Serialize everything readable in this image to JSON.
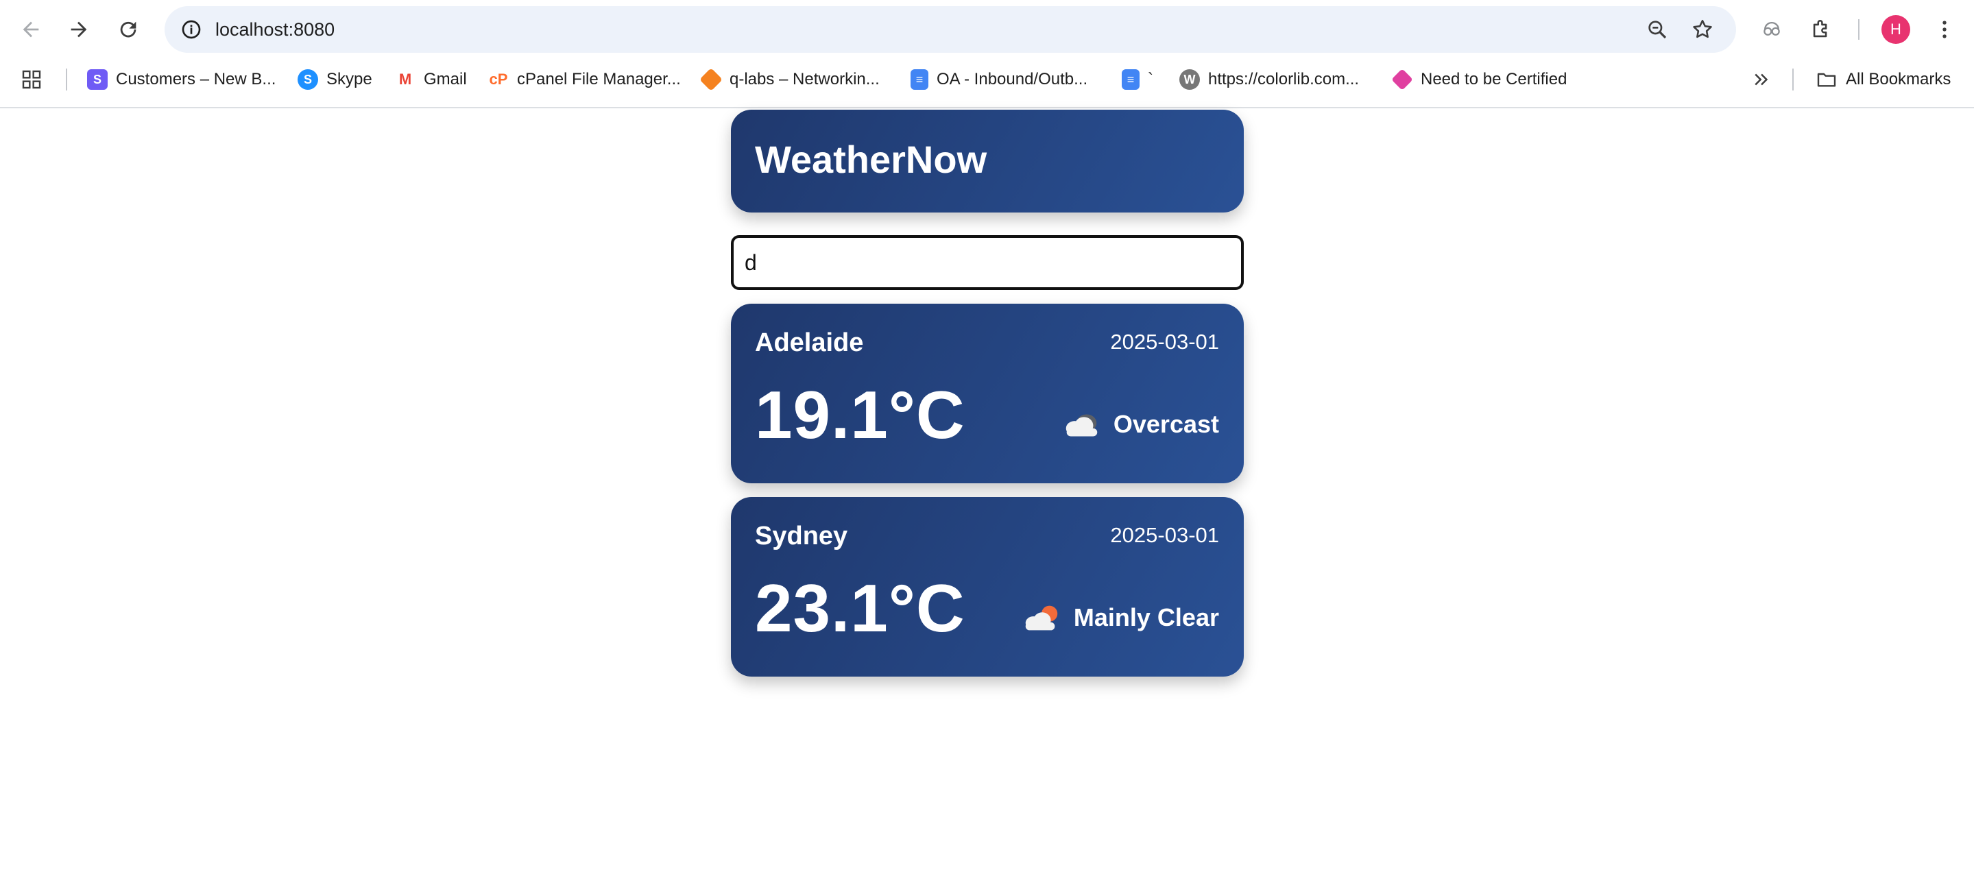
{
  "browser": {
    "url": "localhost:8080",
    "profile_initial": "H",
    "bookmarks": [
      {
        "label": "Customers – New B...",
        "icon": "s-logo-icon",
        "color": "#6f5bf5"
      },
      {
        "label": "Skype",
        "icon": "skype-icon",
        "color": "#1e90ff"
      },
      {
        "label": "Gmail",
        "icon": "gmail-icon",
        "color": "#ea4335"
      },
      {
        "label": "cPanel File Manager...",
        "icon": "cpanel-icon",
        "color": "#ff6c2c"
      },
      {
        "label": "q-labs – Networkin...",
        "icon": "cube-icon",
        "color": "#f58220"
      },
      {
        "label": "OA - Inbound/Outb...",
        "icon": "docs-icon",
        "color": "#4285f4"
      },
      {
        "label": "`",
        "icon": "docs-icon",
        "color": "#4285f4"
      },
      {
        "label": "https://colorlib.com...",
        "icon": "wordpress-icon",
        "color": "#777777"
      },
      {
        "label": "Need to be Certified",
        "icon": "box-icon",
        "color": "#e040a0"
      }
    ],
    "all_bookmarks_label": "All Bookmarks"
  },
  "app": {
    "title": "WeatherNow",
    "search": {
      "value": "d",
      "placeholder": ""
    },
    "results": [
      {
        "city": "Adelaide",
        "date": "2025-03-01",
        "temperature": "19.1°C",
        "condition": "Overcast",
        "icon": "cloud-icon"
      },
      {
        "city": "Sydney",
        "date": "2025-03-01",
        "temperature": "23.1°C",
        "condition": "Mainly Clear",
        "icon": "sun-behind-cloud-icon"
      }
    ]
  }
}
